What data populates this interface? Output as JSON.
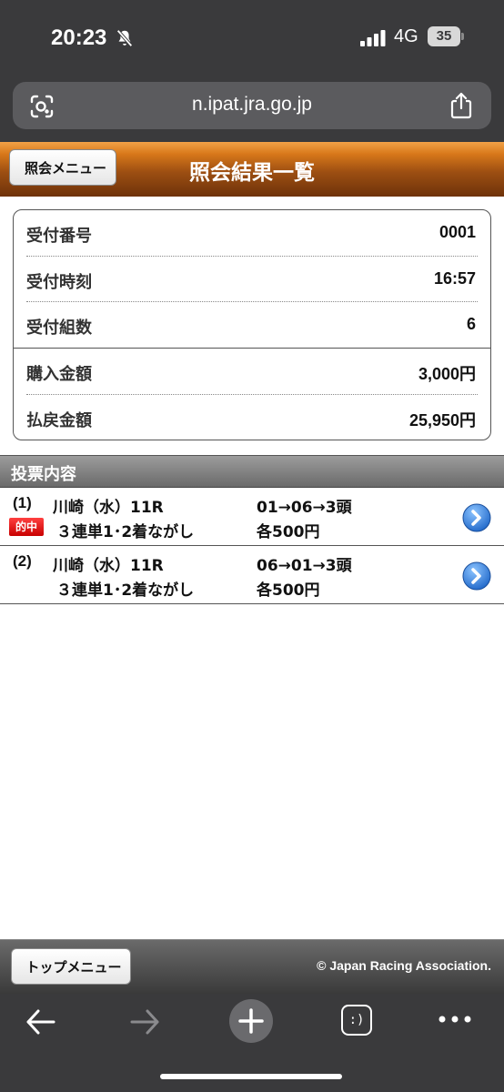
{
  "status_bar": {
    "time": "20:23",
    "network": "4G",
    "battery": "35",
    "icons": [
      "bell-slash-icon",
      "signal-icon"
    ]
  },
  "browser": {
    "url": "n.ipat.jra.go.jp",
    "icons": [
      "lens-icon",
      "share-icon"
    ]
  },
  "header": {
    "back_label": "照会メニュー",
    "title": "照会結果一覧"
  },
  "summary": {
    "rows": [
      {
        "label": "受付番号",
        "value": "0001"
      },
      {
        "label": "受付時刻",
        "value": "16:57"
      },
      {
        "label": "受付組数",
        "value": "6"
      },
      {
        "label": "購入金額",
        "value": "3,000円"
      },
      {
        "label": "払戻金額",
        "value": "25,950円"
      }
    ]
  },
  "bets": {
    "section_title": "投票内容",
    "items": [
      {
        "index": "(1)",
        "badge": "的中",
        "race": "川崎（水）11R",
        "type": "３連単1･2着ながし",
        "combo": "01→06→3頭",
        "amount": "各500円"
      },
      {
        "index": "(2)",
        "badge": "",
        "race": "川崎（水）11R",
        "type": "３連単1･2着ながし",
        "combo": "06→01→3頭",
        "amount": "各500円"
      }
    ],
    "colors": {
      "hit_badge": "#e00000",
      "arrow": "#2f7fd8"
    }
  },
  "footer": {
    "top_menu_label": "トップメニュー",
    "copyright": "© Japan Racing Association."
  },
  "toolbar": {
    "tabs_label": ":)",
    "icons": [
      "back-arrow-icon",
      "forward-arrow-icon",
      "plus-icon",
      "tabs-icon",
      "more-icon"
    ]
  }
}
